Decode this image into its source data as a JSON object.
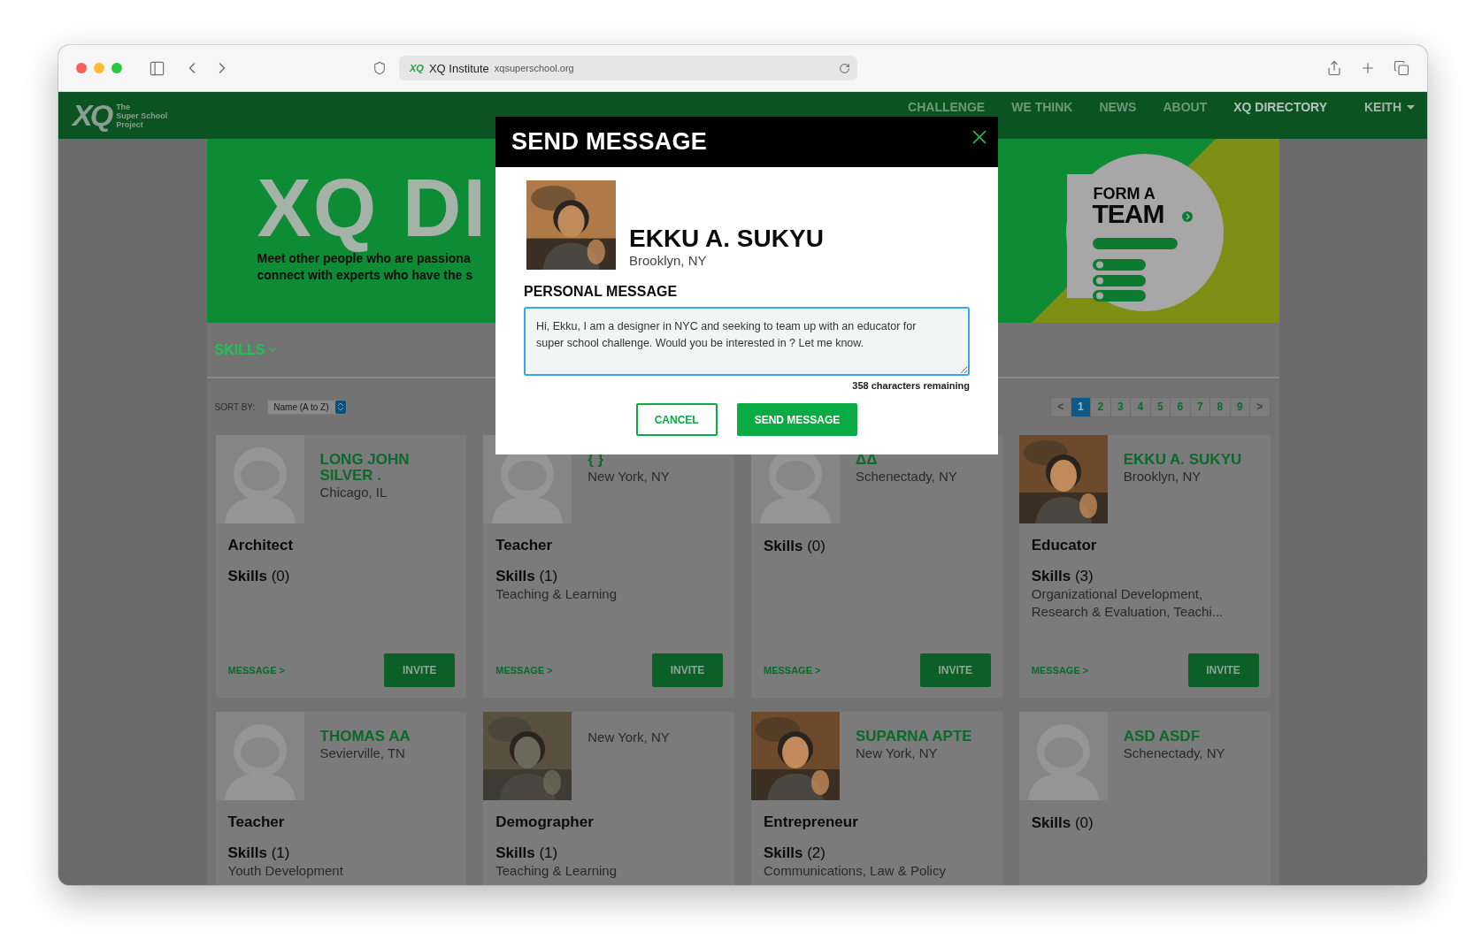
{
  "browser": {
    "favicon": "XQ",
    "site_name": "XQ Institute",
    "url": "xqsuperschool.org"
  },
  "nav": {
    "logo": "XQ",
    "tagline": [
      "The",
      "Super School",
      "Project"
    ],
    "items": [
      {
        "label": "CHALLENGE",
        "selected": false
      },
      {
        "label": "WE THINK",
        "selected": false
      },
      {
        "label": "NEWS",
        "selected": false
      },
      {
        "label": "ABOUT",
        "selected": false
      },
      {
        "label": "XQ DIRECTORY",
        "selected": true
      }
    ],
    "user": "KEITH"
  },
  "banner": {
    "title": "XQ DI",
    "lines": [
      "Meet other people who are passiona",
      "connect with experts who have the s"
    ],
    "promo": [
      "FORM A",
      "TEAM"
    ]
  },
  "filters": {
    "skills": "SKILLS",
    "sort_label": "SORT BY:",
    "sort_value": "Name (A to Z)",
    "prev": "<",
    "next": ">",
    "pages": [
      {
        "label": "1",
        "selected": true
      },
      {
        "label": "2",
        "selected": false
      },
      {
        "label": "3",
        "selected": false
      },
      {
        "label": "4",
        "selected": false
      },
      {
        "label": "5",
        "selected": false
      },
      {
        "label": "6",
        "selected": false
      },
      {
        "label": "7",
        "selected": false
      },
      {
        "label": "8",
        "selected": false
      },
      {
        "label": "9",
        "selected": false
      }
    ]
  },
  "cards": [
    {
      "avatar": {
        "kind": "placeholder"
      },
      "name": "LONG JOHN SILVER .",
      "location": "Chicago, IL",
      "role": "Architect",
      "skills": "**Skills** (0)",
      "message": "MESSAGE >",
      "invite": "INVITE"
    },
    {
      "avatar": {
        "kind": "placeholder"
      },
      "name": "{ }",
      "location": "New York, NY",
      "role": "Teacher",
      "skills": "**Skills** (1)",
      "skill_list": "Teaching & Learning",
      "message": "MESSAGE >",
      "invite": "INVITE"
    },
    {
      "avatar": {
        "kind": "placeholder"
      },
      "name": "ΔΔ",
      "location": "Schenectady, NY",
      "skills": "**Skills** (0)",
      "message": "MESSAGE >",
      "invite": "INVITE"
    },
    {
      "name": "EKKU A. SUKYU",
      "location": "Brooklyn, NY",
      "role": "Educator",
      "skills": "**Skills** (3)",
      "skill_list": "Organizational Development, Research & Evaluation, Teachi...",
      "message": "MESSAGE >",
      "invite": "INVITE"
    },
    {
      "avatar": {
        "kind": "placeholder"
      },
      "name": "THOMAS AA",
      "location": "Sevierville, TN",
      "role": "Teacher",
      "skills": "**Skills** (1)",
      "skill_list": "Youth Development"
    },
    {
      "location": "New York, NY",
      "role": "Demographer",
      "skills": "**Skills** (1)",
      "skill_list": "Teaching & Learning"
    },
    {
      "name": "SUPARNA APTE",
      "location": "New York, NY",
      "role": "Entrepreneur",
      "skills": "**Skills** (2)",
      "skill_list": "Communications, Law & Policy"
    },
    {
      "avatar": {
        "kind": "placeholder"
      },
      "name": "ASD ASDF",
      "location": "Schenectady, NY",
      "skills": "**Skills** (0)"
    }
  ],
  "modal": {
    "title": "SEND MESSAGE",
    "recipient": {
      "name": "EKKU A. SUKYU",
      "location": "Brooklyn, NY"
    },
    "message_label": "PERSONAL MESSAGE",
    "message": "Hi, Ekku, I am a designer in NYC and seeking to team up with an educator for super school challenge. Would you be interested in ? Let me know.",
    "remaining": "358 characters remaining",
    "buttons": [
      {
        "label": "CANCEL",
        "kind": "secondary"
      },
      {
        "label": "SEND MESSAGE",
        "kind": "primary"
      }
    ]
  }
}
